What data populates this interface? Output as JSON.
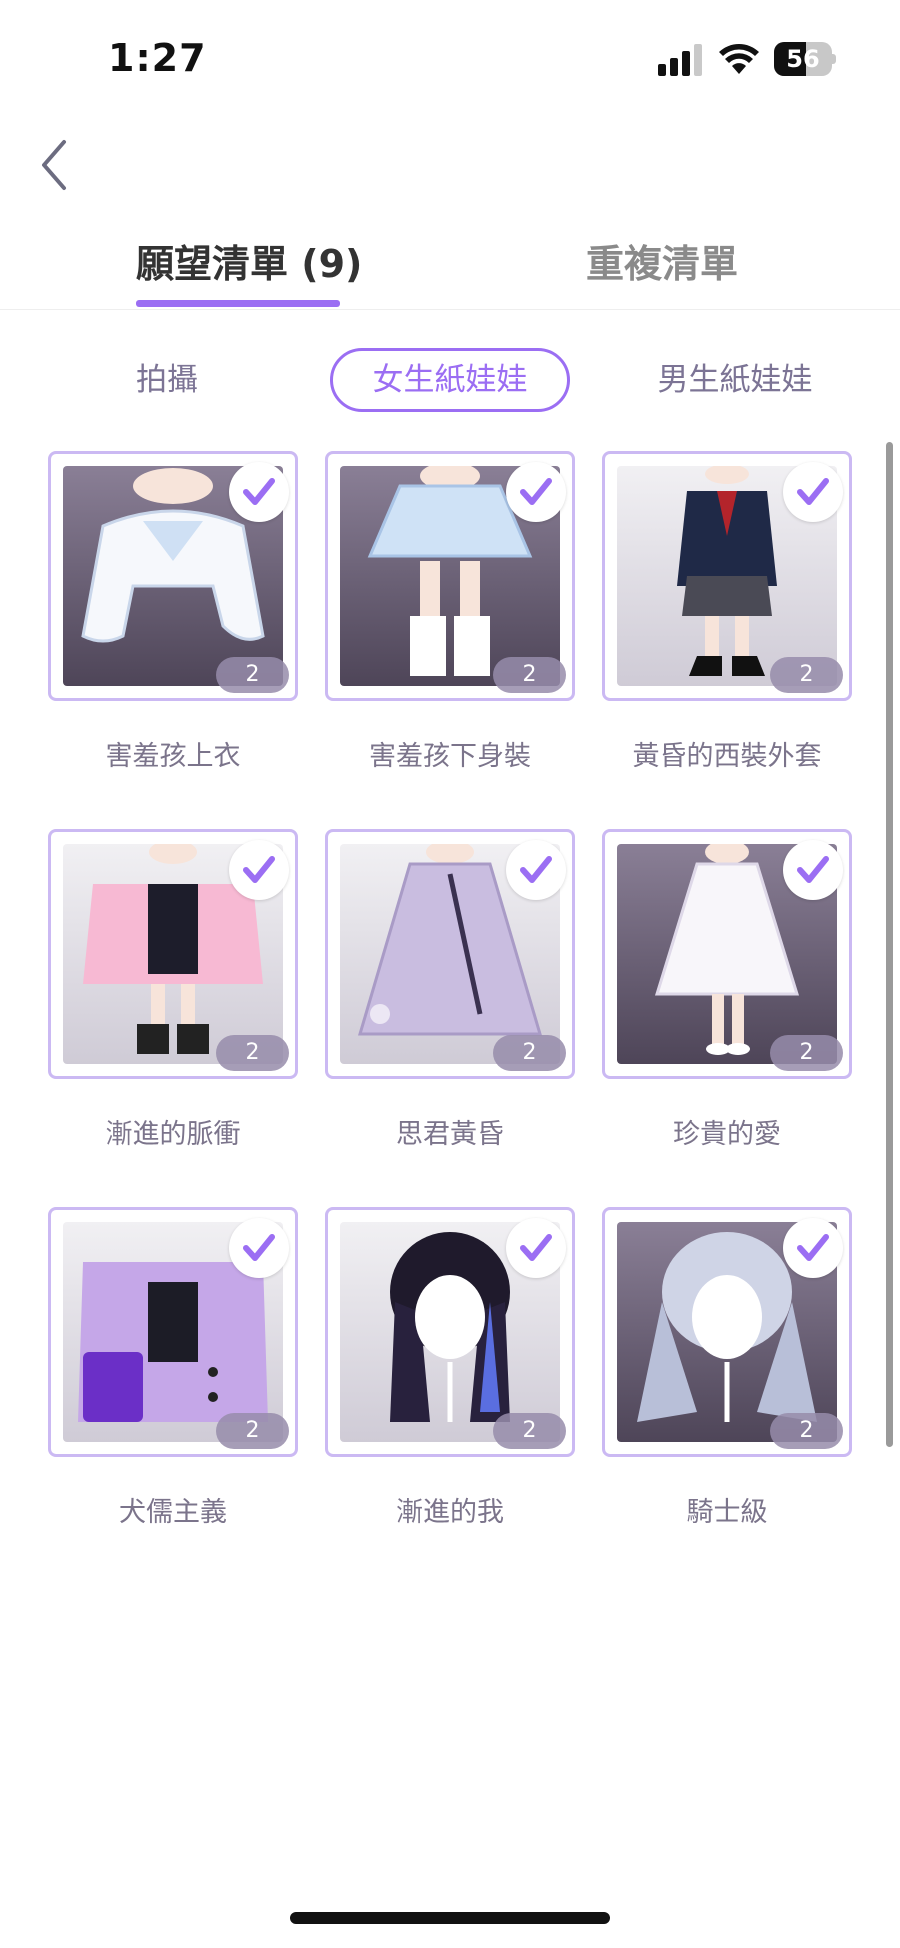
{
  "status_bar": {
    "time": "1:27",
    "battery": "56",
    "battery_level": 0.56
  },
  "tabs": [
    {
      "label": "願望清單 (9)",
      "active": true
    },
    {
      "label": "重複清單",
      "active": false
    }
  ],
  "filters": [
    {
      "label": "拍攝",
      "selected": false
    },
    {
      "label": "女生紙娃娃",
      "selected": true
    },
    {
      "label": "男生紙娃娃",
      "selected": false
    }
  ],
  "accent_color": "#9b6ef3",
  "items": [
    {
      "name": "害羞孩上衣",
      "count": "2",
      "checked": true,
      "background": "dark",
      "art": "white-top"
    },
    {
      "name": "害羞孩下身裝",
      "count": "2",
      "checked": true,
      "background": "dark",
      "art": "blue-skirt"
    },
    {
      "name": "黃昏的西裝外套",
      "count": "2",
      "checked": true,
      "background": "light",
      "art": "navy-blazer"
    },
    {
      "name": "漸進的脈衝",
      "count": "2",
      "checked": true,
      "background": "light",
      "art": "pink-jacket"
    },
    {
      "name": "思君黃昏",
      "count": "2",
      "checked": true,
      "background": "light",
      "art": "lavender-dress"
    },
    {
      "name": "珍貴的愛",
      "count": "2",
      "checked": true,
      "background": "dark",
      "art": "white-dress"
    },
    {
      "name": "犬儒主義",
      "count": "2",
      "checked": true,
      "background": "light",
      "art": "purple-jacket"
    },
    {
      "name": "漸進的我",
      "count": "2",
      "checked": true,
      "background": "light",
      "art": "black-hair"
    },
    {
      "name": "騎士級",
      "count": "2",
      "checked": true,
      "background": "dark",
      "art": "silver-hair"
    }
  ]
}
